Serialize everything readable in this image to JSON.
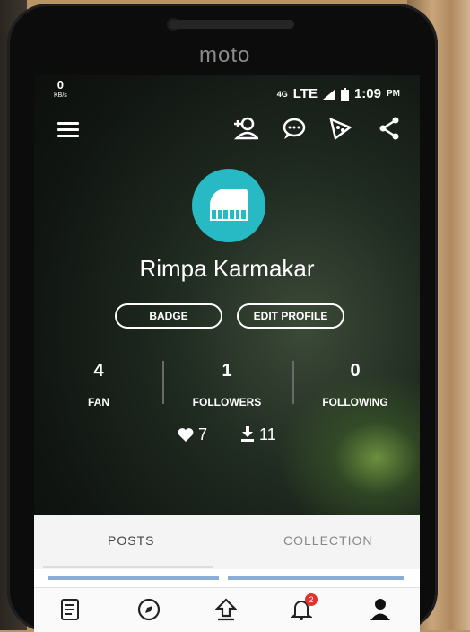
{
  "device": {
    "brand": "moto"
  },
  "status_bar": {
    "net_speed": "0",
    "net_unit": "KB/s",
    "network": "LTE",
    "network_tag": "4G",
    "time": "1:09",
    "ampm": "PM"
  },
  "profile": {
    "name": "Rimpa Karmakar",
    "badge_label": "BADGE",
    "edit_label": "EDIT PROFILE",
    "stats": [
      {
        "value": "4",
        "label": "FAN"
      },
      {
        "value": "1",
        "label": "FOLLOWERS"
      },
      {
        "value": "0",
        "label": "FOLLOWING"
      }
    ],
    "likes": "7",
    "downloads": "11"
  },
  "tabs": {
    "posts": "POSTS",
    "collection": "COLLECTION"
  },
  "bottom_nav": {
    "notifications_count": "2"
  },
  "icons": {
    "menu": "hamburger-menu-icon",
    "add_user": "add-user-icon",
    "chat": "chat-icon",
    "pizza": "pizza-icon",
    "share": "share-icon",
    "avatar": "piano-icon"
  },
  "colors": {
    "avatar_bg": "#27b9c4",
    "notif_badge": "#e0332b"
  }
}
